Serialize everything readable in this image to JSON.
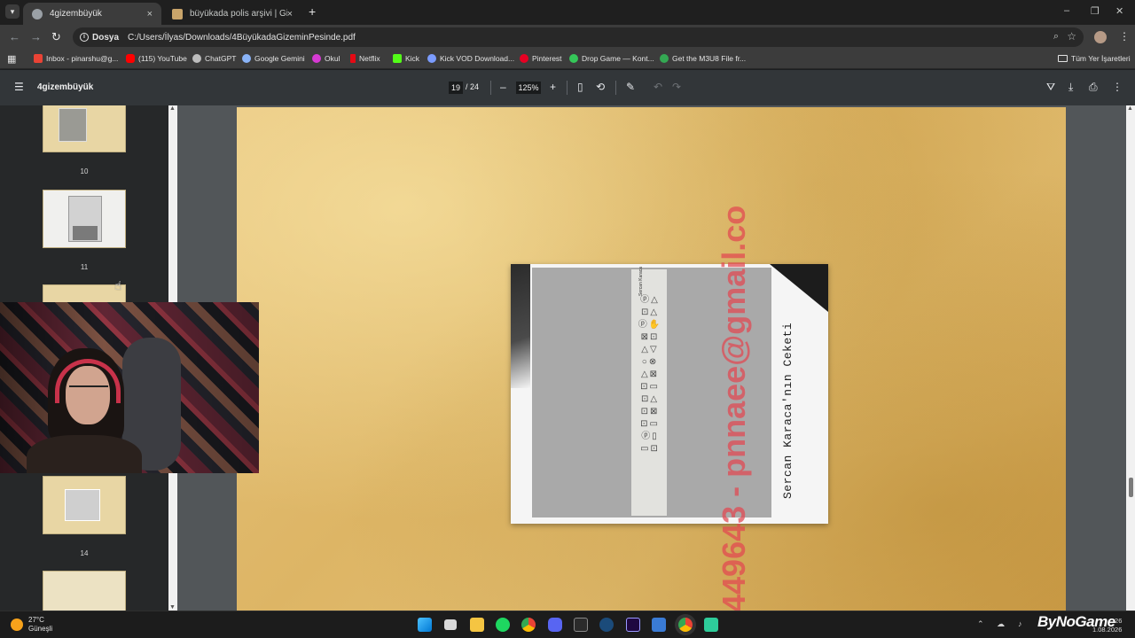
{
  "browser": {
    "tabs": [
      {
        "label": "4gizembüyük",
        "active": true,
        "favicon_color": "#9aa0a6"
      },
      {
        "label": "büyükada polis arşivi | Gizemin",
        "active": false,
        "favicon_color": "#c9a46a"
      }
    ],
    "new_tab": "+",
    "tab_close": "×",
    "window_controls": {
      "minimize": "–",
      "restore": "❐",
      "close": "✕"
    },
    "address": {
      "chip_label": "Dosya",
      "url": "C:/Users/İlyas/Downloads/4BüyükadaGizeminPesinde.pdf"
    },
    "bookmarks": [
      {
        "label": "Inbox - pinarshu@g...",
        "color": "#ea4335"
      },
      {
        "label": "(115) YouTube",
        "color": "#ff0000"
      },
      {
        "label": "ChatGPT",
        "color": "#bdbdbd"
      },
      {
        "label": "Google Gemini",
        "color": "#8ab4f8"
      },
      {
        "label": "Okul",
        "color": "#d63ad3"
      },
      {
        "label": "Netflix",
        "color": "#e50914"
      },
      {
        "label": "Kick",
        "color": "#53fc18"
      },
      {
        "label": "Kick VOD Download...",
        "color": "#7b9cff"
      },
      {
        "label": "Pinterest",
        "color": "#e60023"
      },
      {
        "label": "Drop Game — Kont...",
        "color": "#35c759"
      },
      {
        "label": "Get the M3U8 File fr...",
        "color": "#34a853"
      }
    ],
    "bookmarks_folder": "Tüm Yer İşaretleri"
  },
  "pdf": {
    "title": "4gizembüyük",
    "current_page": "19",
    "page_total": "/ 24",
    "zoom": "125%",
    "zoom_out": "–",
    "zoom_in": "+",
    "thumbnails": [
      {
        "label": "10"
      },
      {
        "label": "11"
      },
      {
        "label": "14"
      }
    ],
    "page_content": {
      "caption": "Sercan Karaca'nın Ceketi",
      "label_header": "Sercan Karaca",
      "watermark": "449643 - pnnaee@gmail.co"
    }
  },
  "taskbar": {
    "weather_temp": "27°C",
    "weather_desc": "Güneşli",
    "brand": "ByNoGame",
    "clock_time": "...26",
    "clock_date": "1.08.2026"
  }
}
